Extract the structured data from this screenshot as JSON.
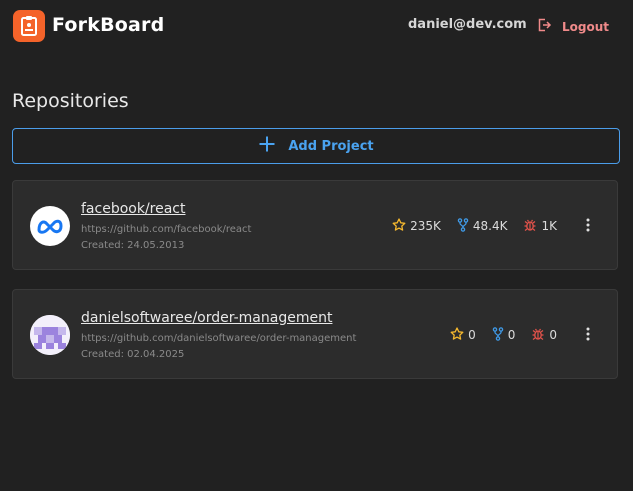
{
  "header": {
    "brand": "ForkBoard",
    "user_email": "daniel@dev.com",
    "logout_label": "Logout",
    "accent_color": "#f4632a"
  },
  "main": {
    "title": "Repositories",
    "add_button_label": "Add Project",
    "repositories": [
      {
        "name": "facebook/react",
        "url": "https://github.com/facebook/react",
        "created": "Created: 24.05.2013",
        "avatar_icon": "meta-logo-icon",
        "stars": "235K",
        "forks": "48.4K",
        "issues": "1K"
      },
      {
        "name": "danielsoftwaree/order-management",
        "url": "https://github.com/danielsoftwaree/order-management",
        "created": "Created: 02.04.2025",
        "avatar_icon": "identicon-icon",
        "stars": "0",
        "forks": "0",
        "issues": "0"
      }
    ]
  },
  "colors": {
    "star": "#f5b82e",
    "fork": "#3f9ae8",
    "issue": "#e5534b",
    "link": "#4aa3f0"
  }
}
